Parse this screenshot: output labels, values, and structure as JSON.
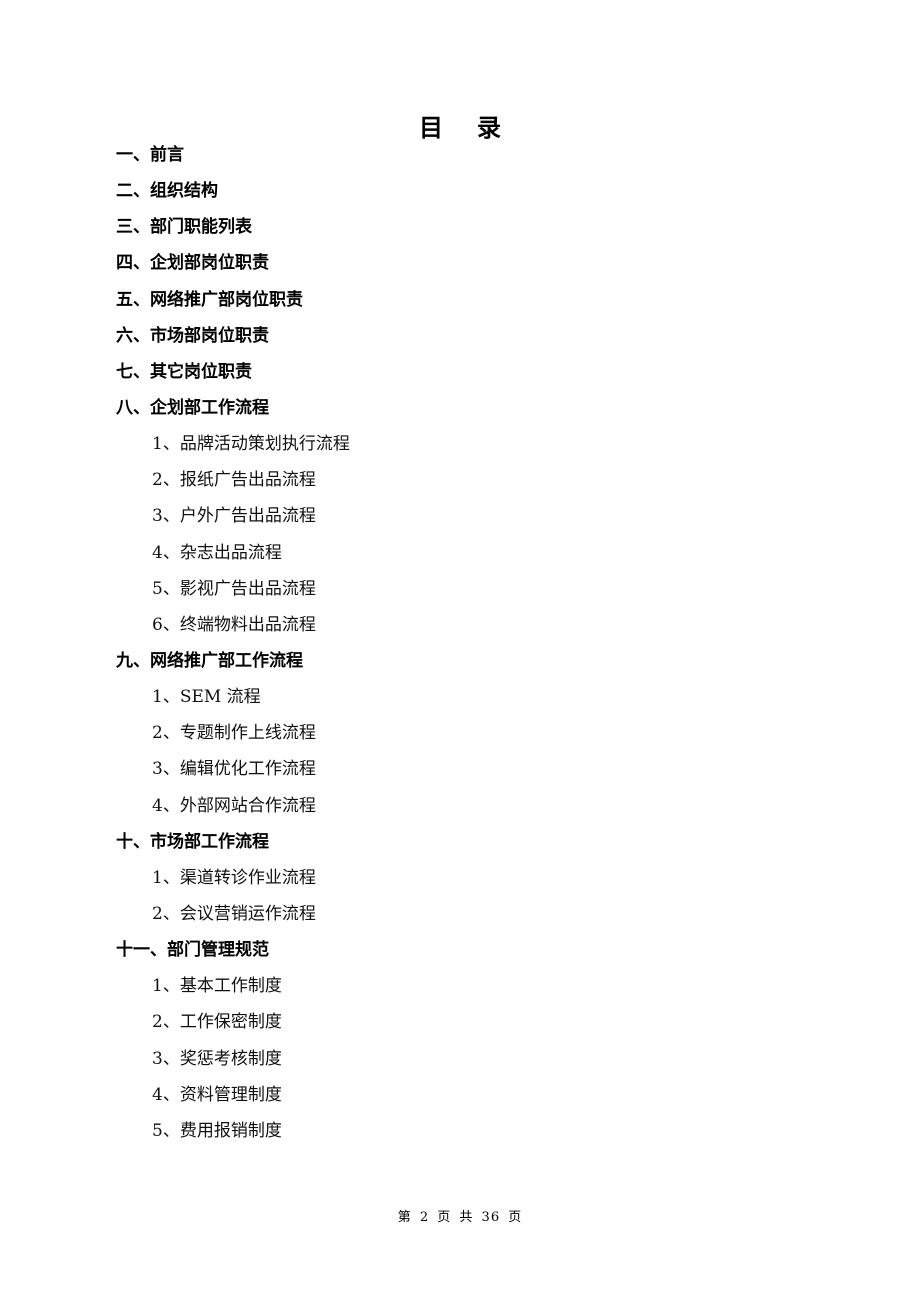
{
  "document": {
    "title": "目录",
    "toc": [
      {
        "level": 1,
        "text": "一、前言"
      },
      {
        "level": 1,
        "text": "二、组织结构"
      },
      {
        "level": 1,
        "text": "三、部门职能列表"
      },
      {
        "level": 1,
        "text": "四、企划部岗位职责"
      },
      {
        "level": 1,
        "text": "五、网络推广部岗位职责"
      },
      {
        "level": 1,
        "text": "六、市场部岗位职责"
      },
      {
        "level": 1,
        "text": "七、其它岗位职责"
      },
      {
        "level": 1,
        "text": "八、企划部工作流程"
      },
      {
        "level": 2,
        "text": "1、品牌活动策划执行流程"
      },
      {
        "level": 2,
        "text": "2、报纸广告出品流程"
      },
      {
        "level": 2,
        "text": "3、户外广告出品流程"
      },
      {
        "level": 2,
        "text": "4、杂志出品流程"
      },
      {
        "level": 2,
        "text": "5、影视广告出品流程"
      },
      {
        "level": 2,
        "text": "6、终端物料出品流程"
      },
      {
        "level": 1,
        "text": "九、网络推广部工作流程"
      },
      {
        "level": 2,
        "text": "1、SEM 流程"
      },
      {
        "level": 2,
        "text": "2、专题制作上线流程"
      },
      {
        "level": 2,
        "text": "3、编辑优化工作流程"
      },
      {
        "level": 2,
        "text": "4、外部网站合作流程"
      },
      {
        "level": 1,
        "text": "十、市场部工作流程"
      },
      {
        "level": 2,
        "text": "1、渠道转诊作业流程"
      },
      {
        "level": 2,
        "text": "2、会议营销运作流程"
      },
      {
        "level": 1,
        "text": "十一、部门管理规范"
      },
      {
        "level": 2,
        "text": "1、基本工作制度"
      },
      {
        "level": 2,
        "text": "2、工作保密制度"
      },
      {
        "level": 2,
        "text": "3、奖惩考核制度"
      },
      {
        "level": 2,
        "text": "4、资料管理制度"
      },
      {
        "level": 2,
        "text": "5、费用报销制度"
      }
    ],
    "footer": "第 2 页 共 36 页"
  }
}
